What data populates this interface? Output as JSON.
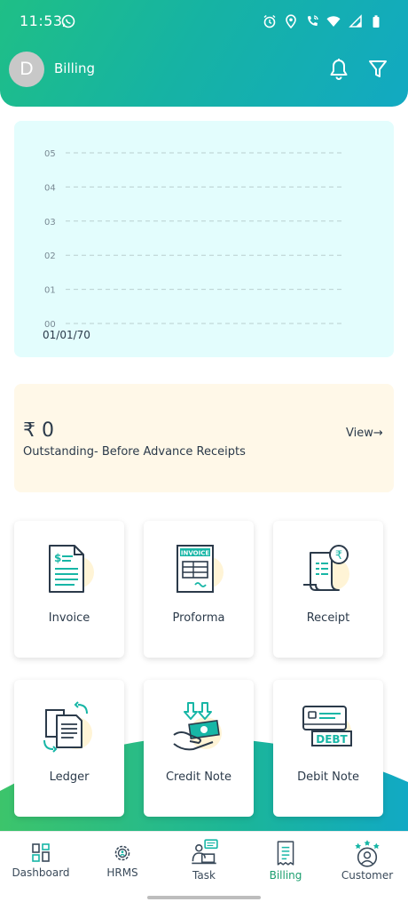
{
  "status_bar": {
    "time": "11:53"
  },
  "header": {
    "avatar_letter": "D",
    "title": "Billing"
  },
  "chart_data": {
    "type": "line",
    "title": "",
    "xlabel": "",
    "ylabel": "",
    "y_tick_labels": [
      "00",
      "01",
      "02",
      "03",
      "04",
      "05"
    ],
    "x_tick_labels": [
      "01/01/70"
    ],
    "ylim": [
      0,
      5
    ],
    "grid": true,
    "series": []
  },
  "outstanding": {
    "amount": "₹ 0",
    "label": "Outstanding- Before Advance Receipts",
    "view_label": "View→"
  },
  "tiles": [
    {
      "label": "Invoice"
    },
    {
      "label": "Proforma"
    },
    {
      "label": "Receipt"
    },
    {
      "label": "Ledger"
    },
    {
      "label": "Credit Note"
    },
    {
      "label": "Debit Note"
    }
  ],
  "icon_text": {
    "invoice": "INVOICE",
    "debt": "DEBT",
    "rupee": "₹"
  },
  "bottom_nav": [
    {
      "label": "Dashboard"
    },
    {
      "label": "HRMS"
    },
    {
      "label": "Task"
    },
    {
      "label": "Billing"
    },
    {
      "label": "Customer"
    }
  ],
  "colors": {
    "header_gradient": [
      "#1fbf86",
      "#12a9c2"
    ],
    "chart_bg": "#e3fdfd",
    "outstanding_bg": "#fff8e8",
    "active_nav": "#1a9e6e",
    "icon_dark": "#2b3a4a",
    "icon_teal": "#17b6a6"
  }
}
